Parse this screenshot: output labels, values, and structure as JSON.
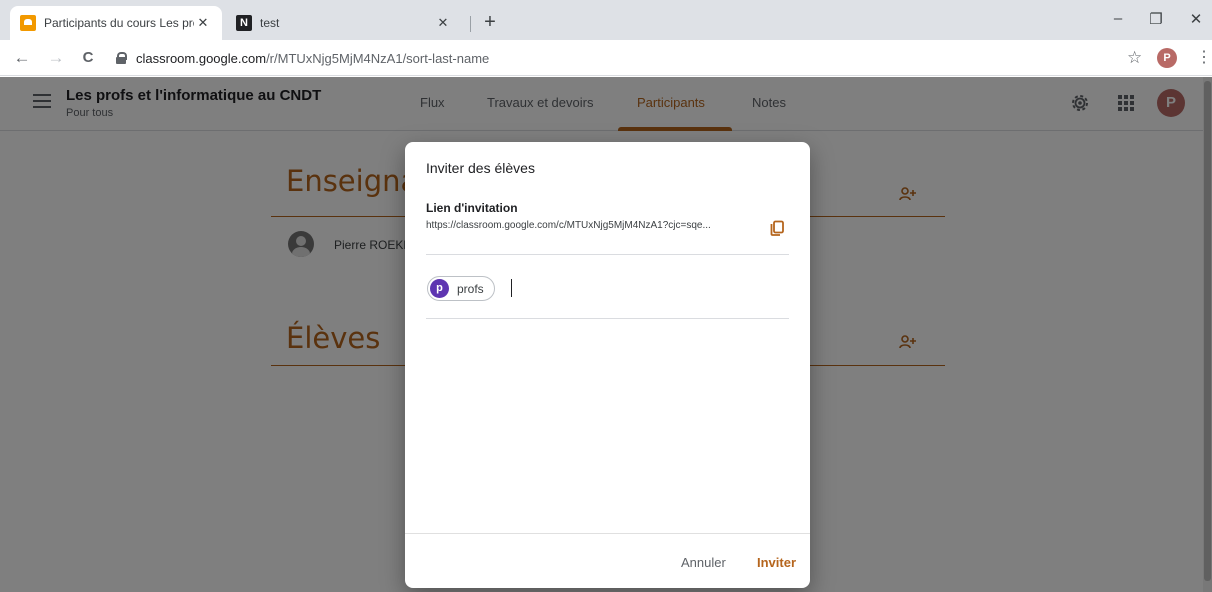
{
  "browser": {
    "tabs": [
      {
        "title": "Participants du cours Les profs et l'informatique au CNDT",
        "close": "✕"
      },
      {
        "title": "test",
        "close": "✕"
      }
    ],
    "new_tab": "+",
    "window_controls": {
      "minimize": "–",
      "maximize": "❐",
      "close": "✕"
    },
    "nav": {
      "back": "←",
      "forward": "→",
      "reload": "C"
    },
    "url_host": "classroom.google.com",
    "url_path": "/r/MTUxNjg5MjM4NzA1/sort-last-name",
    "bookmark_star": "☆",
    "profile_initial": "P",
    "menu": "⋮"
  },
  "app": {
    "course_title": "Les profs et l'informatique au CNDT",
    "course_subtitle": "Pour tous",
    "nav_tabs": [
      "Flux",
      "Travaux et devoirs",
      "Participants",
      "Notes"
    ],
    "active_tab": "Participants",
    "account_initial": "P"
  },
  "roster": {
    "teachers_title": "Enseignants",
    "teacher_name": "Pierre ROEKENS",
    "students_title": "Élèves"
  },
  "dialog": {
    "title": "Inviter des élèves",
    "link_label": "Lien d'invitation",
    "link_url": "https://classroom.google.com/c/MTUxNjg5MjM4NzA1?cjc=sqe...",
    "chip_initial": "p",
    "chip_label": "profs",
    "cancel_label": "Annuler",
    "invite_label": "Inviter"
  },
  "colors": {
    "accent": "#b5651d",
    "chip_avatar": "#5e35b1",
    "profile": "#b86a66"
  }
}
